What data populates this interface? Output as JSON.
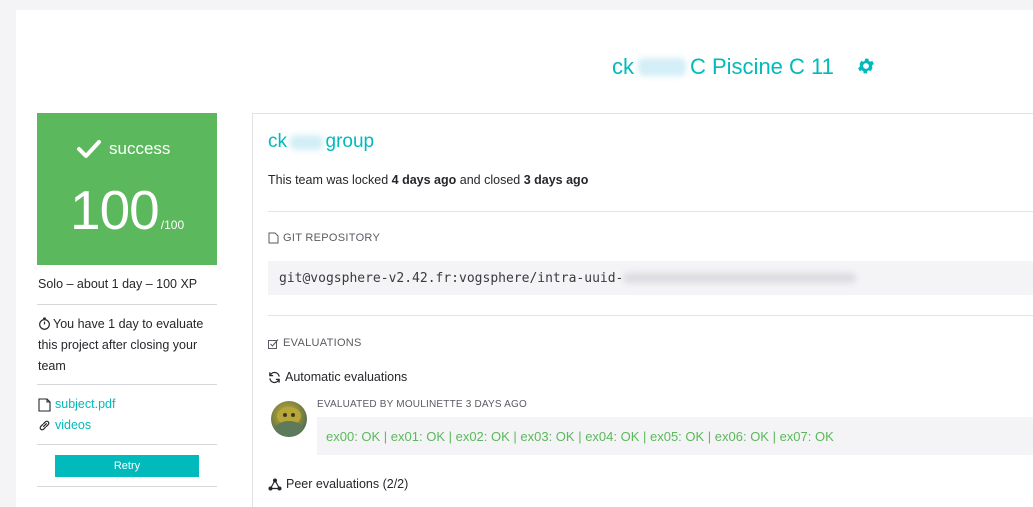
{
  "header": {
    "title_prefix": "ck",
    "title_redacted": "xxxxxx",
    "title_suffix": "C Piscine C 11"
  },
  "score_card": {
    "status": "success",
    "score": "100",
    "max": "/100",
    "color": "#5cb85c"
  },
  "sidebar": {
    "meta": "Solo – about 1 day – 100 XP",
    "eval_note": "You have 1 day to evaluate this project after closing your team",
    "links": [
      {
        "label": "subject.pdf",
        "icon": "document-icon"
      },
      {
        "label": "videos",
        "icon": "link-icon"
      }
    ],
    "retry_label": "Retry"
  },
  "panel": {
    "group_prefix": "ck",
    "group_redacted": "xxxxx",
    "group_suffix": "group",
    "locked_pre": "This team was locked ",
    "locked_time": "4 days ago",
    "locked_mid": " and closed ",
    "closed_time": "3 days ago",
    "git_heading": "GIT REPOSITORY",
    "repo_url": "git@vogsphere-v2.42.fr:vogsphere/intra-uuid-",
    "repo_redacted": "xxxxxxxx-xxxx-xxxx-xxxx-xxxxxxxxxxxx-xxxxxx",
    "evaluations_heading": "EVALUATIONS",
    "auto_label": "Automatic evaluations",
    "evaluated_by": "EVALUATED BY MOULINETTE 3 DAYS AGO",
    "result": "ex00: OK | ex01: OK | ex02: OK | ex03: OK | ex04: OK | ex05: OK | ex06: OK | ex07: OK",
    "peer_label": "Peer evaluations (2/2)"
  },
  "colors": {
    "accent": "#00babc",
    "success": "#5cb85c"
  }
}
